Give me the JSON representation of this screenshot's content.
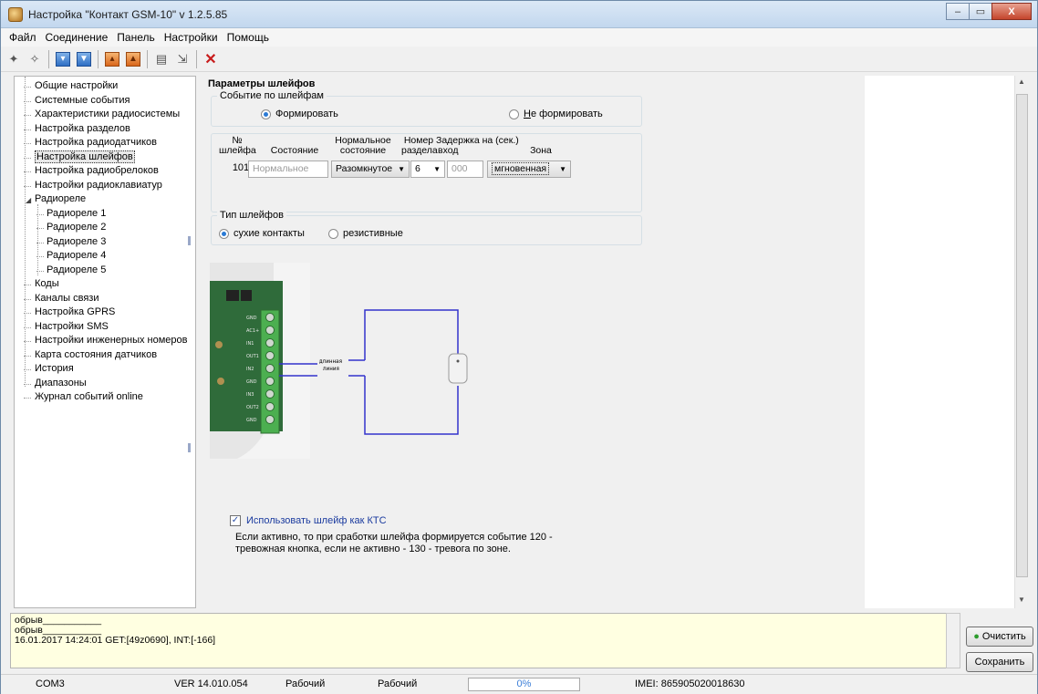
{
  "window": {
    "title": "Настройка \"Контакт GSM-10\" v 1.2.5.85",
    "buttons": [
      "–",
      "▭",
      "X"
    ]
  },
  "menu": [
    "Файл",
    "Соединение",
    "Панель",
    "Настройки",
    "Помощь"
  ],
  "tree": {
    "items": [
      "Общие настройки",
      "Системные события",
      "Характеристики радиосистемы",
      "Настройка разделов",
      "Настройка радиодатчиков",
      "Настройка шлейфов",
      "Настройка радиобрелоков",
      "Настройки радиоклавиатур",
      "Радиореле",
      "Радиореле 1",
      "Радиореле 2",
      "Радиореле 3",
      "Радиореле 4",
      "Радиореле 5",
      "Коды",
      "Каналы связи",
      "Настройка GPRS",
      "Настройки SMS",
      "Настройки инженерных номеров",
      "Карта состояния датчиков",
      "История",
      "Диапазоны",
      "Журнал событий online"
    ],
    "selected": "Настройка шлейфов"
  },
  "params": {
    "title": "Параметры шлейфов",
    "event_group": {
      "legend": "Событие по шлейфам",
      "form": "Формировать",
      "no_form_prefix": "Н",
      "no_form_rest": "е формировать"
    },
    "table": {
      "h_num_1": "№",
      "h_num_2": "шлейфа",
      "h_state": "Состояние",
      "h_normal_1": "Нормальное",
      "h_normal_2": "состояние",
      "h_section_1": "Номер",
      "h_section_2": "раздела",
      "h_delay_1": "Задержка на (сек.)",
      "h_delay_2": "вход",
      "h_zone": "Зона",
      "row": {
        "num": "101",
        "state": "Нормальное",
        "normal": "Разомкнутое",
        "section": "6",
        "delay": "000",
        "zone": "мгновенная"
      }
    },
    "type_group": {
      "legend": "Тип шлейфов",
      "dry": "сухие контакты",
      "resistive": "резистивные"
    },
    "diagram_label_1": "длинная",
    "diagram_label_2": "линия",
    "terminal_labels": [
      "GND",
      "AC1+",
      "IN1",
      "OUT1",
      "IN2",
      "GND",
      "IN3",
      "OUT2",
      "GND"
    ],
    "kts": {
      "checkbox_label": "Использовать шлейф как КТС",
      "desc_1": "Если активно, то при сработки шлейфа формируется событие 120 -",
      "desc_2": "тревожная кнопка, если не активно - 130 - тревога по зоне."
    }
  },
  "log": {
    "lines": [
      "обрыв___________",
      "обрыв___________",
      "16.01.2017 14:24:01 GET:[49z0690], INT:[-166]"
    ]
  },
  "buttons": {
    "clear": "Очистить",
    "save": "Сохранить"
  },
  "status": {
    "port": "COM3",
    "version": "VER 14.010.054",
    "mode1": "Рабочий",
    "mode2": "Рабочий",
    "progress": "0%",
    "imei": "IMEI: 865905020018630"
  },
  "colors": {
    "accent": "#2a7ad5",
    "wire": "#3333cc",
    "board": "#2f6b3a",
    "terminal": "#4caf50",
    "log_bg": "#ffffe1"
  }
}
